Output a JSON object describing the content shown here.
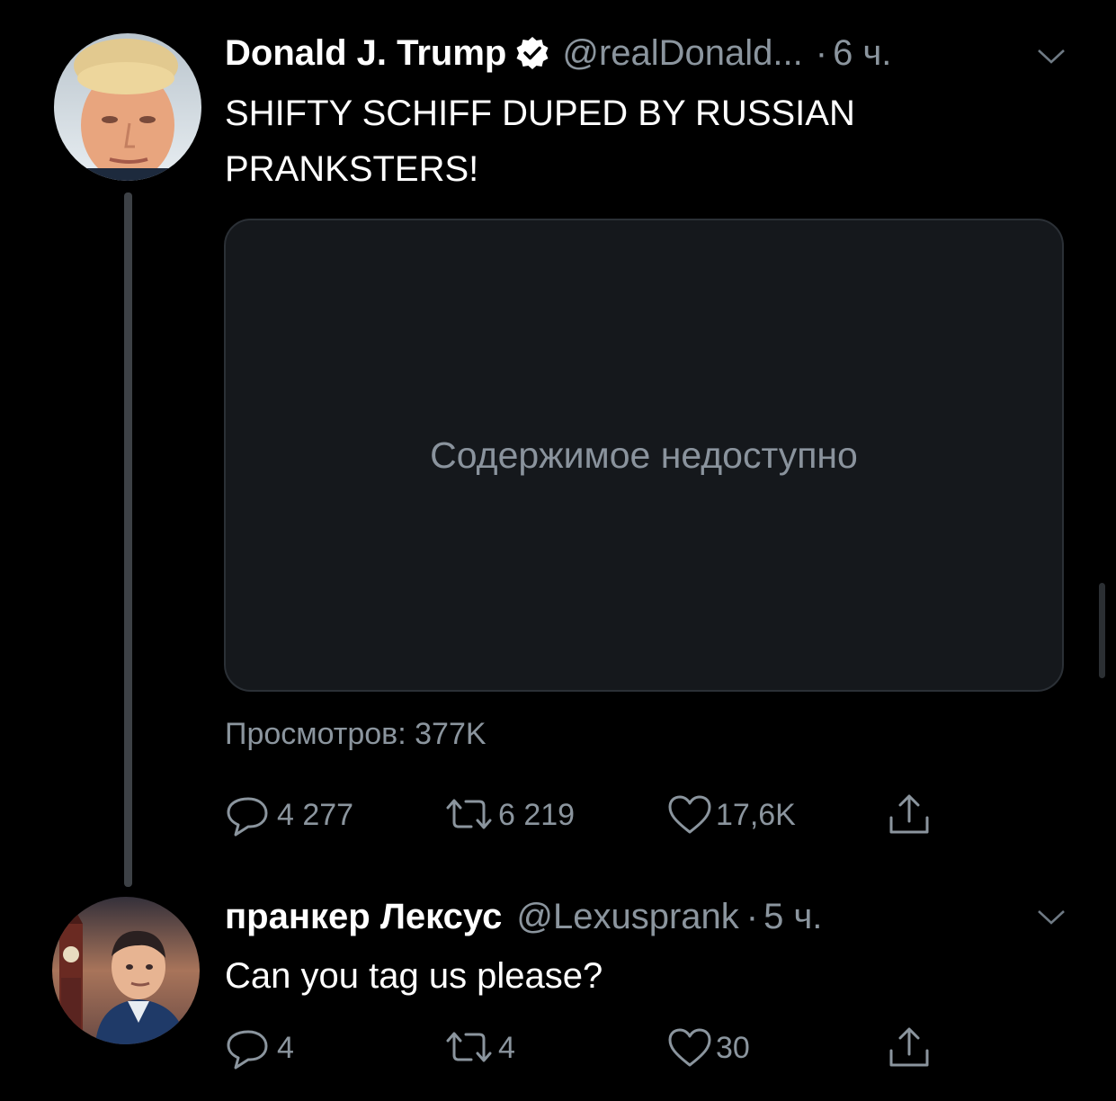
{
  "tweets": [
    {
      "name": "Donald J. Trump",
      "handle": "@realDonald...",
      "separator": "·",
      "time": "6 ч.",
      "text_line1": "SHIFTY SCHIFF DUPED BY RUSSIAN",
      "text_line2": "PRANKSTERS!",
      "media_unavailable": "Содержимое недоступно",
      "views": "Просмотров: 377K",
      "replies": "4 277",
      "retweets": "6 219",
      "likes": "17,6K"
    },
    {
      "name": "пранкер Лексус",
      "handle": "@Lexusprank",
      "separator": "·",
      "time": "5 ч.",
      "text": "Can you tag us please?",
      "replies": "4",
      "retweets": "4",
      "likes": "30"
    }
  ],
  "icons": {
    "verified": "verified-badge-icon",
    "menu": "chevron-down-icon",
    "reply": "speech-bubble-icon",
    "retweet": "retweet-arrows-icon",
    "like": "heart-icon",
    "share": "share-upload-icon"
  },
  "colors": {
    "background": "#000000",
    "text": "#ffffff",
    "muted": "#8b959e",
    "thread_line": "#3d4146",
    "media_bg": "#15181c"
  }
}
